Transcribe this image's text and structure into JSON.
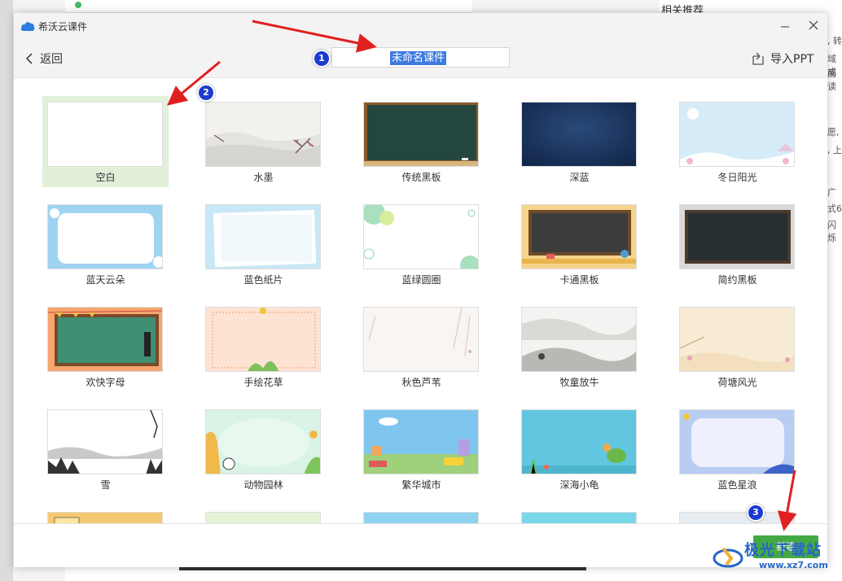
{
  "window": {
    "title": "希沃云课件",
    "minimize_icon": "minimize-icon",
    "close_icon": "close-icon"
  },
  "navbar": {
    "back_label": "返回",
    "courseware_name": "未命名课件",
    "import_label": "导入PPT"
  },
  "templates": [
    {
      "label": "空白",
      "selected": true
    },
    {
      "label": "水墨"
    },
    {
      "label": "传统黑板"
    },
    {
      "label": "深蓝"
    },
    {
      "label": "冬日阳光"
    },
    {
      "label": "蓝天云朵"
    },
    {
      "label": "蓝色纸片"
    },
    {
      "label": "蓝绿圆圈"
    },
    {
      "label": "卡通黑板"
    },
    {
      "label": "简约黑板"
    },
    {
      "label": "欢快字母"
    },
    {
      "label": "手绘花草"
    },
    {
      "label": "秋色芦苇"
    },
    {
      "label": "牧童放牛"
    },
    {
      "label": "荷塘风光"
    },
    {
      "label": "雪"
    },
    {
      "label": "动物园林"
    },
    {
      "label": "繁华城市"
    },
    {
      "label": "深海小龟"
    },
    {
      "label": "蓝色星浪"
    }
  ],
  "footer": {
    "new_label": "新建"
  },
  "annotations": {
    "badge1": "1",
    "badge2": "2",
    "badge3": "3",
    "arrow_color": "#e02020"
  },
  "background": {
    "right_title": "相关推荐",
    "right_fragments": [
      ",  转",
      "域成",
      "画读",
      "愿,",
      ", 上",
      "广",
      "式6",
      "闪烁"
    ]
  },
  "watermark": {
    "text": "极光下载站",
    "url": "www.xz7.com"
  },
  "colors": {
    "accent_green": "#44a945",
    "selected_bg": "#e2f0d9",
    "badge_blue": "#1b3ccf"
  }
}
